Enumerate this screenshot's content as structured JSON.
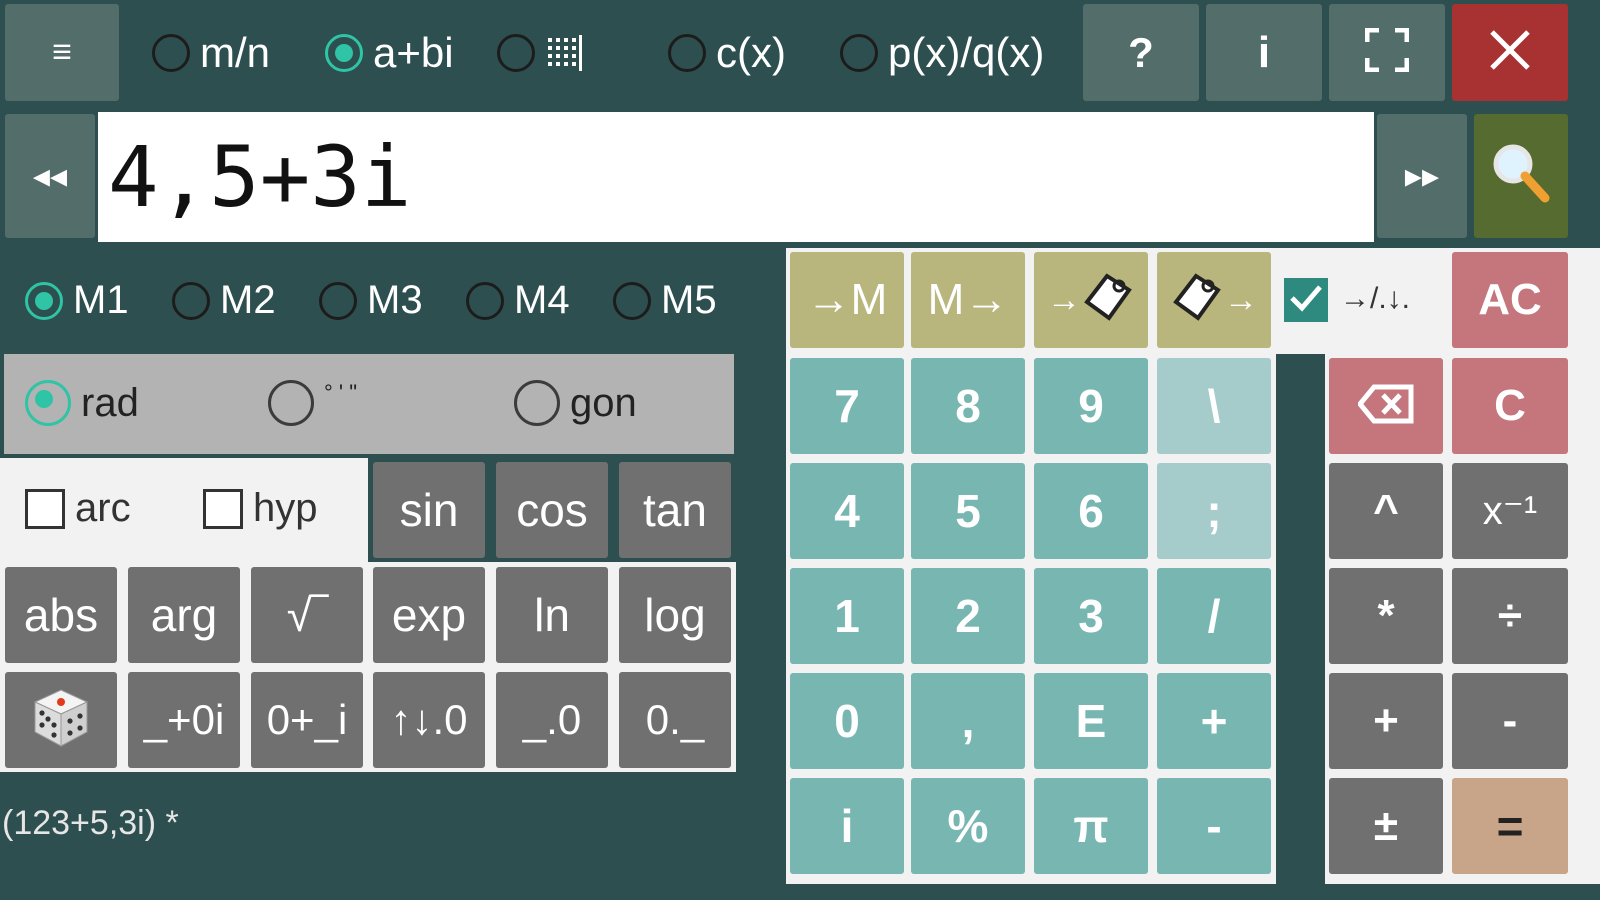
{
  "topbar": {
    "menu_icon": "hamburger-icon",
    "modes": [
      {
        "label": "m/n",
        "selected": false
      },
      {
        "label": "a+bi",
        "selected": true
      },
      {
        "label": "",
        "icon": "matrix-icon",
        "selected": false
      },
      {
        "label": "c(x)",
        "selected": false
      },
      {
        "label": "p(x)/q(x)",
        "selected": false
      }
    ],
    "help_label": "?",
    "info_label": "i",
    "fullscreen_icon": "fullscreen-icon",
    "close_icon": "close-icon"
  },
  "input": {
    "prev_label": "◂◂",
    "value": "4,5+3i",
    "next_label": "▸▸",
    "search_icon": "magnifier-icon"
  },
  "memory": {
    "slots": [
      "M1",
      "M2",
      "M3",
      "M4",
      "M5"
    ],
    "selected": "M1",
    "store_label": "→M",
    "recall_label": "M→",
    "copy_icon": "clipboard-icon",
    "check_label": "→/.↓.",
    "checked": true,
    "ac_label": "AC"
  },
  "angle": {
    "units": [
      "rad",
      "° ' \"",
      "gon"
    ],
    "selected": "rad"
  },
  "trig": {
    "arc_label": "arc",
    "hyp_label": "hyp",
    "sin": "sin",
    "cos": "cos",
    "tan": "tan"
  },
  "functions": {
    "row1": [
      "abs",
      "arg",
      "√‾",
      "exp",
      "ln",
      "log"
    ],
    "row2": [
      "",
      "_+0i",
      "0+_i",
      "↑↓.0",
      "_.0",
      "0._"
    ],
    "dice_icon": "dice-icon"
  },
  "keypad": {
    "rows": [
      [
        "7",
        "8",
        "9",
        "\\"
      ],
      [
        "4",
        "5",
        "6",
        ";"
      ],
      [
        "1",
        "2",
        "3",
        "/"
      ],
      [
        "0",
        ",",
        "E",
        "+"
      ],
      [
        "i",
        "%",
        "π",
        "-"
      ]
    ]
  },
  "ops": {
    "backspace_icon": "backspace-icon",
    "rows": [
      [
        "",
        "C"
      ],
      [
        "^",
        "x⁻¹"
      ],
      [
        "*",
        "÷"
      ],
      [
        "+",
        "-"
      ],
      [
        "±",
        "="
      ]
    ]
  },
  "history": {
    "text": "(123+5,3i) *"
  },
  "colors": {
    "background": "#2e4f4f",
    "radio_accent": "#2ec4a5",
    "close_button": "#a83232",
    "search_button": "#556b2f"
  }
}
